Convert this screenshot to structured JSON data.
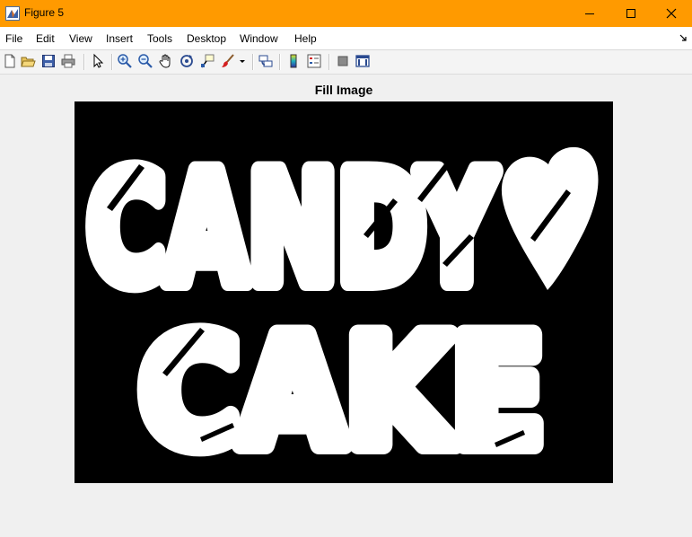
{
  "window": {
    "title": "Figure 5",
    "titlebar_color": "#ff9a00",
    "controls": [
      "minimize-icon",
      "maximize-icon",
      "close-icon"
    ]
  },
  "menubar": {
    "items": [
      "File",
      "Edit",
      "View",
      "Insert",
      "Tools",
      "Desktop",
      "Window",
      "Help"
    ]
  },
  "toolbar": {
    "icons": [
      "new-figure-icon",
      "open-file-icon",
      "save-icon",
      "print-icon",
      "edit-plot-arrow-icon",
      "zoom-in-icon",
      "zoom-out-icon",
      "pan-hand-icon",
      "rotate-3d-icon",
      "data-cursor-icon",
      "brush-icon",
      "brush-dropdown-icon",
      "link-plot-icon",
      "insert-colorbar-icon",
      "insert-legend-icon",
      "hide-plot-tools-icon",
      "show-plot-tools-icon"
    ]
  },
  "axes": {
    "title": "Fill Image",
    "background": "#000000",
    "foreground": "#ffffff",
    "image_text_line1": "CANDY",
    "image_text_line2": "CAKE",
    "image_heart_icon": "heart-icon"
  }
}
